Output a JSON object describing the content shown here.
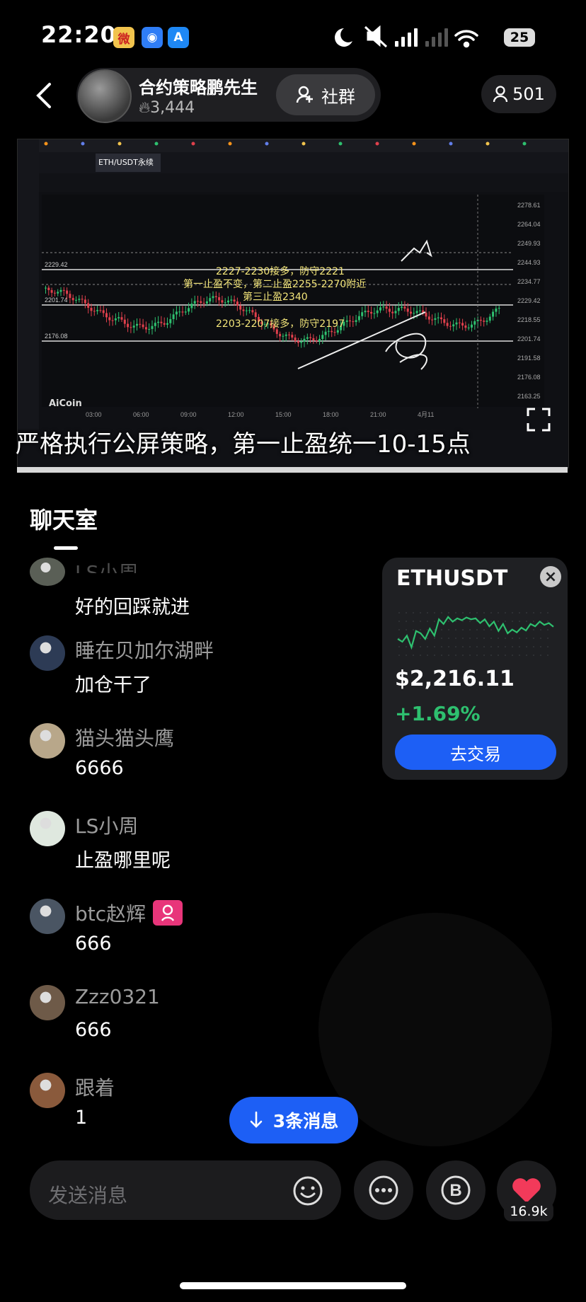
{
  "status_bar": {
    "time": "22:20",
    "battery": "25"
  },
  "header": {
    "host_name": "合约策略鹏先生",
    "likes": "3,444",
    "group_label": "社群",
    "viewers": "501"
  },
  "stream": {
    "caption": "严格执行公屏策略，第一止盈统一10-15点",
    "ann_line1": "2227-2230接多，防守2221",
    "ann_line2": "第一止盈不变，第二止盈2255-2270附近",
    "ann_line3": "第三止盈2340",
    "ann_line4": "2203-2207接多，防守2197",
    "brand": "AiCoin",
    "pair": "ETH/USDT永续",
    "price_labels": [
      "2278.61",
      "2264.04",
      "2249.93",
      "2244.93",
      "2234.77",
      "2229.42",
      "2218.55",
      "2201.74",
      "2191.58",
      "2176.08",
      "2163.25"
    ],
    "left_labels": [
      "2229.42",
      "2201.74",
      "2176.08"
    ],
    "time_labels": [
      "03:00",
      "06:00",
      "09:00",
      "12:00",
      "15:00",
      "18:00",
      "21:00",
      "4月11"
    ]
  },
  "chat": {
    "title": "聊天室",
    "messages": [
      {
        "name": "LS小周",
        "text": "好的回踩就进"
      },
      {
        "name": "睡在贝加尔湖畔",
        "text": "加仓干了"
      },
      {
        "name": "猫头猫头鹰",
        "text": "6666"
      },
      {
        "name": "LS小周",
        "text": "止盈哪里呢"
      },
      {
        "name": "btc赵辉",
        "text": "666"
      },
      {
        "name": "Zzz0321",
        "text": "666"
      },
      {
        "name": "跟着",
        "text": "1"
      }
    ]
  },
  "ticker": {
    "symbol": "ETHUSDT",
    "price": "$2,216.11",
    "change": "+1.69%",
    "button": "去交易",
    "color_up": "#2ec06f",
    "series": [
      0.62,
      0.68,
      0.55,
      0.8,
      0.45,
      0.5,
      0.62,
      0.4,
      0.55,
      0.2,
      0.3,
      0.15,
      0.25,
      0.18,
      0.22,
      0.16,
      0.2,
      0.18,
      0.28,
      0.2,
      0.35,
      0.25,
      0.45,
      0.3,
      0.5,
      0.42,
      0.48,
      0.38,
      0.44,
      0.3,
      0.35,
      0.25,
      0.32,
      0.28,
      0.36
    ]
  },
  "new_messages": "3条消息",
  "input": {
    "placeholder": "发送消息"
  },
  "likes_count": "16.9k"
}
